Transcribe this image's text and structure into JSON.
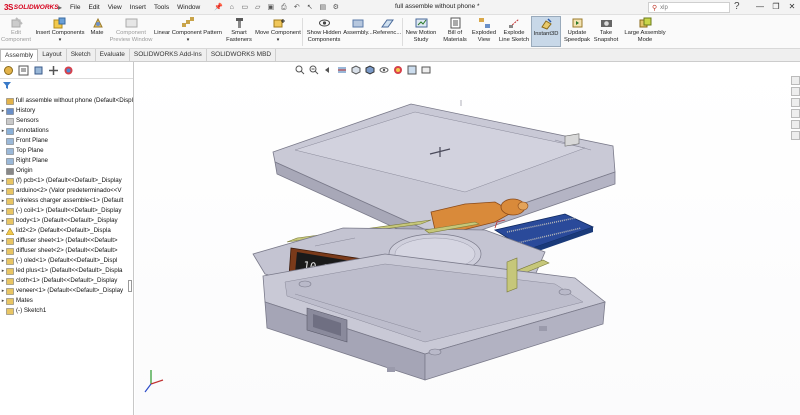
{
  "app": {
    "brand_ds": "3S",
    "brand_name": "SOLIDWORKS",
    "document_title": "full assemble without phone *",
    "search_placeholder": "xlp"
  },
  "menu": [
    "File",
    "Edit",
    "View",
    "Insert",
    "Tools",
    "Window"
  ],
  "ribbon": {
    "edit_component": [
      "Edit",
      "Component"
    ],
    "insert_components": "Insert Components",
    "mate": "Mate",
    "component_preview": [
      "Component",
      "Preview Window"
    ],
    "linear_pattern": "Linear Component Pattern",
    "smart_fasteners": [
      "Smart",
      "Fasteners"
    ],
    "move_component": "Move Component",
    "show_hidden": [
      "Show Hidden",
      "Components"
    ],
    "assembly": "Assembly...",
    "reference": "Referenc...",
    "new_motion": [
      "New Motion",
      "Study"
    ],
    "bom": [
      "Bill of",
      "Materials"
    ],
    "exploded_view": [
      "Exploded",
      "View"
    ],
    "explode_line": [
      "Explode",
      "Line Sketch"
    ],
    "instant3d": "Instant3D",
    "update_speedpak": [
      "Update",
      "Speedpak"
    ],
    "take_snapshot": [
      "Take",
      "Snapshot"
    ],
    "large_assembly": [
      "Large Assembly",
      "Mode"
    ]
  },
  "tabs": [
    "Assembly",
    "Layout",
    "Sketch",
    "Evaluate",
    "SOLIDWORKS Add-Ins",
    "SOLIDWORKS MBD"
  ],
  "tree": [
    {
      "label": "full assemble without phone  (Default<Displ",
      "root": true
    },
    {
      "label": "History",
      "exp": "▸"
    },
    {
      "label": "Sensors"
    },
    {
      "label": "Annotations",
      "exp": "▸"
    },
    {
      "label": "Front Plane"
    },
    {
      "label": "Top Plane"
    },
    {
      "label": "Right Plane"
    },
    {
      "label": "Origin"
    },
    {
      "label": "(f) pcb<1> (Default<<Default>_Display",
      "exp": "▸"
    },
    {
      "label": "arduino<2> (Valor predeterminado<<V",
      "exp": "▸"
    },
    {
      "label": "wireless charger assemble<1> (Default",
      "exp": "▸"
    },
    {
      "label": "(-) coil<1> (Default<<Default>_Display",
      "exp": "▸"
    },
    {
      "label": "body<1> (Default<<Default>_Display",
      "exp": "▸"
    },
    {
      "label": "lid2<2> (Default<<Default>_Displa",
      "exp": "▸",
      "warn": true
    },
    {
      "label": "diffuser sheet<1> (Default<<Default>",
      "exp": "▸"
    },
    {
      "label": "diffuser sheet<2> (Default<<Default>",
      "exp": "▸"
    },
    {
      "label": "(-) oled<1> (Default<<Default>_Displ",
      "exp": "▸"
    },
    {
      "label": "led plus<1> (Default<<Default>_Displa",
      "exp": "▸"
    },
    {
      "label": "cloth<1> (Default<<Default>_Display",
      "exp": "▸"
    },
    {
      "label": "veneer<1> (Default<<Default>_Display",
      "exp": "▸"
    },
    {
      "label": "Mates",
      "exp": "▸"
    },
    {
      "label": "(-) Sketch1"
    }
  ],
  "model": {
    "clock_text": "10:15 AM"
  },
  "colors": {
    "brand_red": "#d6001c",
    "model_gray": "#b9b9c9",
    "board_blue": "#2a4a9a",
    "coil_orange": "#d98a3a",
    "diffuser_green": "#c6c77a"
  }
}
